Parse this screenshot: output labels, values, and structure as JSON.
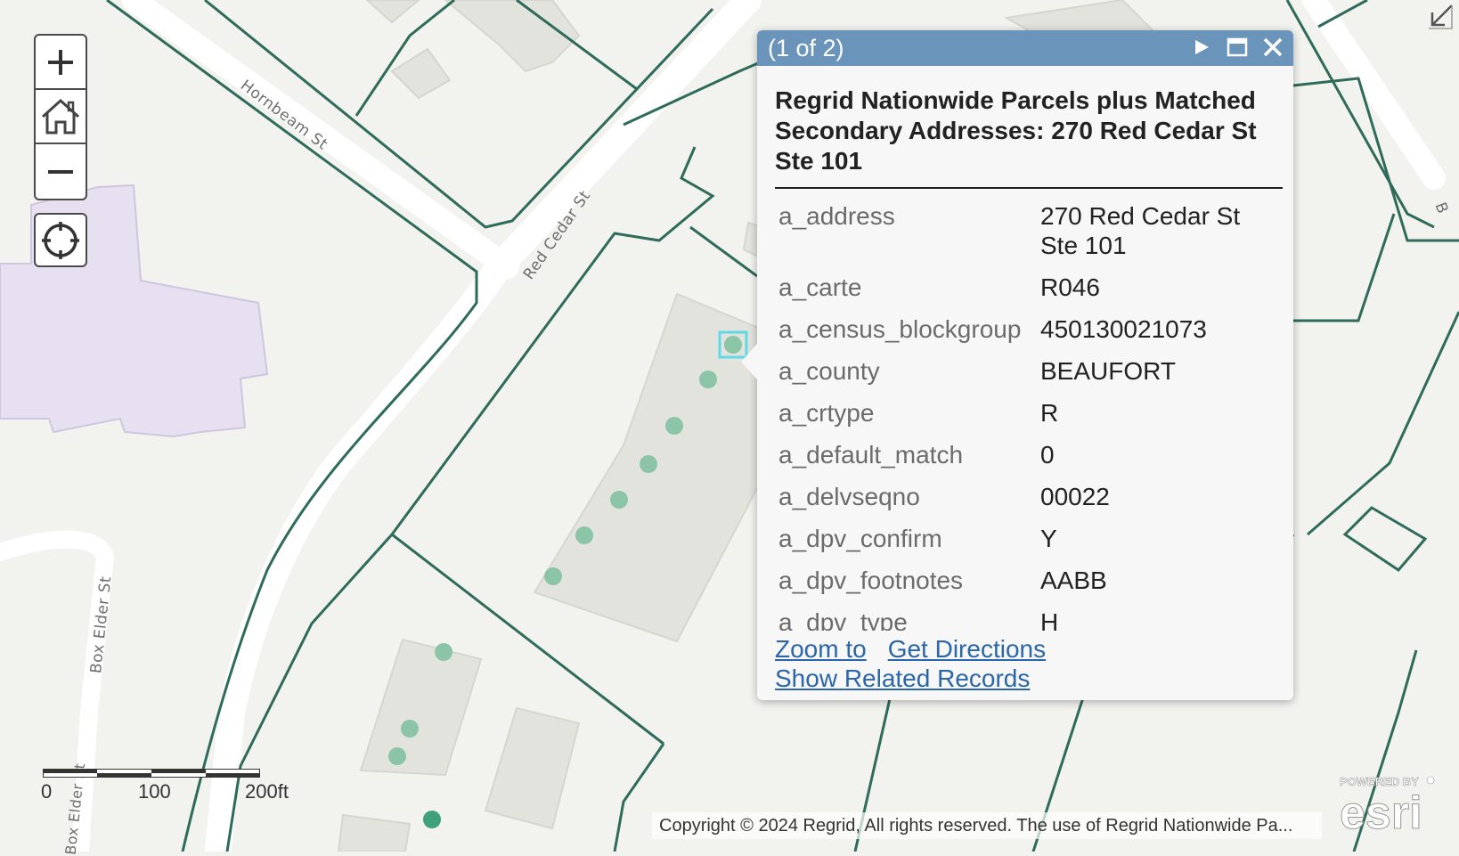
{
  "map": {
    "road_labels": {
      "hornbeam": "Hornbeam St",
      "red_cedar": "Red Cedar St",
      "box_elder": "Box Elder St",
      "box_elder_2": "Box Elder St",
      "edge_partial": "B"
    },
    "colors": {
      "background": "#f2f2ee",
      "parcel_line": "#2e6b5a",
      "road": "#ffffff",
      "building": "#e3e3dd",
      "school_building": "#e6e0f0",
      "point": "#8cc4a8",
      "selected_point_highlight": "#5fd9e8"
    }
  },
  "controls": {
    "zoom_in_icon": "plus-icon",
    "home_icon": "home-icon",
    "zoom_out_icon": "minus-icon",
    "locate_icon": "crosshair-icon"
  },
  "popup": {
    "pager": "(1 of 2)",
    "title": "Regrid Nationwide Parcels plus Matched Secondary Addresses: 270 Red Cedar St Ste 101",
    "attributes": [
      {
        "key": "a_address",
        "value": "270 Red Cedar St Ste 101"
      },
      {
        "key": "a_carte",
        "value": "R046"
      },
      {
        "key": "a_census_blockgroup",
        "value": "450130021073"
      },
      {
        "key": "a_county",
        "value": "BEAUFORT"
      },
      {
        "key": "a_crtype",
        "value": "R"
      },
      {
        "key": "a_default_match",
        "value": "0"
      },
      {
        "key": "a_delvseqno",
        "value": "00022"
      },
      {
        "key": "a_dpv_confirm",
        "value": "Y"
      },
      {
        "key": "a_dpv_footnotes",
        "value": "AABB"
      },
      {
        "key": "a_dpv_type",
        "value": "H"
      }
    ],
    "actions": {
      "zoom_to": "Zoom to",
      "get_directions": "Get Directions",
      "show_related": "Show Related Records"
    }
  },
  "scalebar": {
    "label_0": "0",
    "label_100": "100",
    "label_200": "200ft"
  },
  "attribution": "Copyright © 2024 Regrid, All rights reserved. The use of Regrid Nationwide Pa...",
  "logo": {
    "powered_by": "POWERED BY",
    "brand": "esri"
  }
}
